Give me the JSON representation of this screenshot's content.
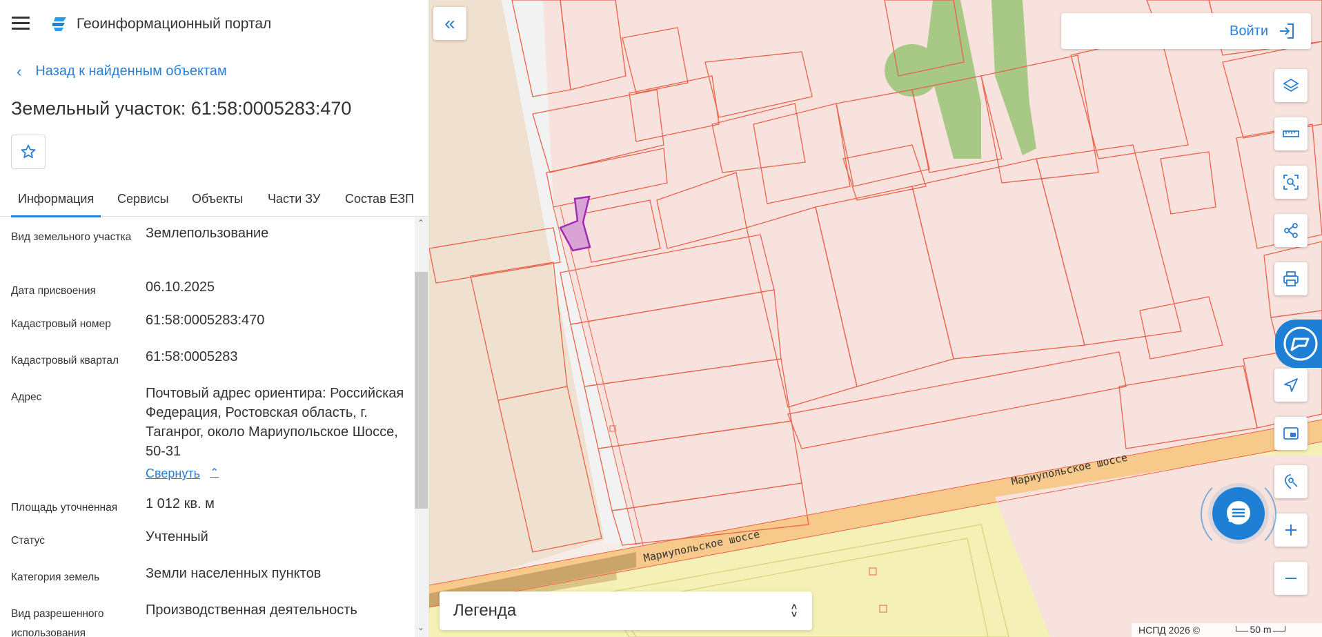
{
  "app": {
    "title": "Геоинформационный портал"
  },
  "nav": {
    "back_label": "Назад к найденным объектам"
  },
  "object": {
    "title": "Земельный участок: 61:58:0005283:470"
  },
  "tabs": [
    {
      "label": "Информация",
      "active": true
    },
    {
      "label": "Сервисы",
      "active": false
    },
    {
      "label": "Объекты",
      "active": false
    },
    {
      "label": "Части ЗУ",
      "active": false
    },
    {
      "label": "Состав ЕЗП",
      "active": false
    }
  ],
  "info_rows": [
    {
      "label": "Вид земельного участка",
      "value": "Землепользование"
    },
    {
      "label": "Дата присвоения",
      "value": "06.10.2025"
    },
    {
      "label": "Кадастровый номер",
      "value": "61:58:0005283:470"
    },
    {
      "label": "Кадастровый квартал",
      "value": "61:58:0005283"
    },
    {
      "label": "Адрес",
      "value": "Почтовый адрес ориентира: Российская Федерация, Ростовская область, г. Таганрог, около Мариупольское Шоссе, 50-31"
    },
    {
      "label": "Площадь уточненная",
      "value": "1 012 кв. м"
    },
    {
      "label": "Статус",
      "value": "Учтенный"
    },
    {
      "label": "Категория земель",
      "value": "Земли населенных пунктов"
    },
    {
      "label": "Вид разрешенного использования",
      "value": "Производственная деятельность"
    }
  ],
  "address_toggle": "Свернуть",
  "map": {
    "login_label": "Войти",
    "legend_label": "Легенда",
    "attribution": "НСПД 2026 ©",
    "scale_label": "50 m",
    "street_labels": [
      "Мариупольское шоссе",
      "Мариупольское шоссе"
    ],
    "tools": [
      "layers-icon",
      "ruler-icon",
      "area-select-icon",
      "share-icon",
      "print-icon",
      "assistant-icon",
      "locate-icon",
      "minimap-icon",
      "geolocation-icon",
      "zoom-in-icon",
      "zoom-out-icon"
    ],
    "colors": {
      "accent": "#1f7fd4",
      "parcel_fill": "#f7e1dc",
      "parcel_stroke": "#e8624a",
      "selected_parcel": "#a12bb5",
      "green_area": "#9dc77a",
      "road": "#f7c98a",
      "yellow_zone": "#f5f0b5"
    }
  }
}
